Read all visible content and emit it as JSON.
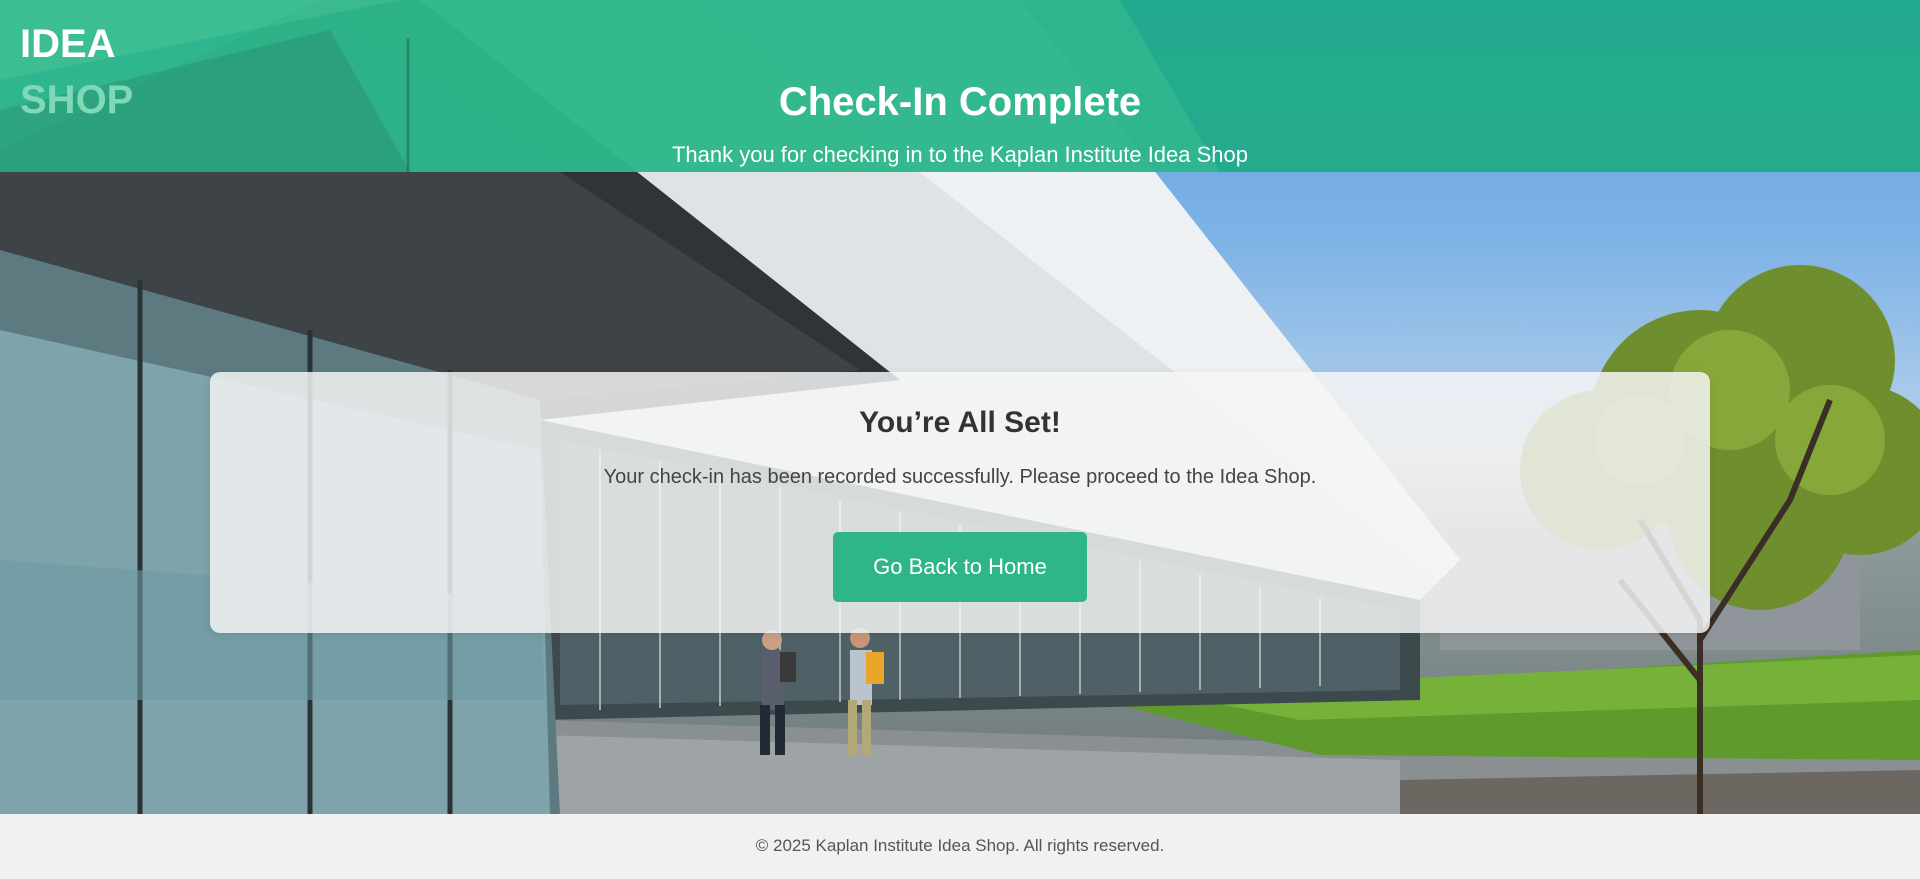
{
  "brand": {
    "line1": "IDEA",
    "line2": "SHOP"
  },
  "header": {
    "title": "Check-In Complete",
    "subtitle": "Thank you for checking in to the Kaplan Institute Idea Shop"
  },
  "card": {
    "title": "You’re All Set!",
    "message": "Your check-in has been recorded successfully. Please proceed to the Idea Shop.",
    "button_label": "Go Back to Home"
  },
  "footer": {
    "text": "© 2025 Kaplan Institute Idea Shop. All rights reserved."
  },
  "colors": {
    "header_green": "#1eab88",
    "button_green": "#2fb687",
    "logo_light": "#7fd9b6"
  }
}
